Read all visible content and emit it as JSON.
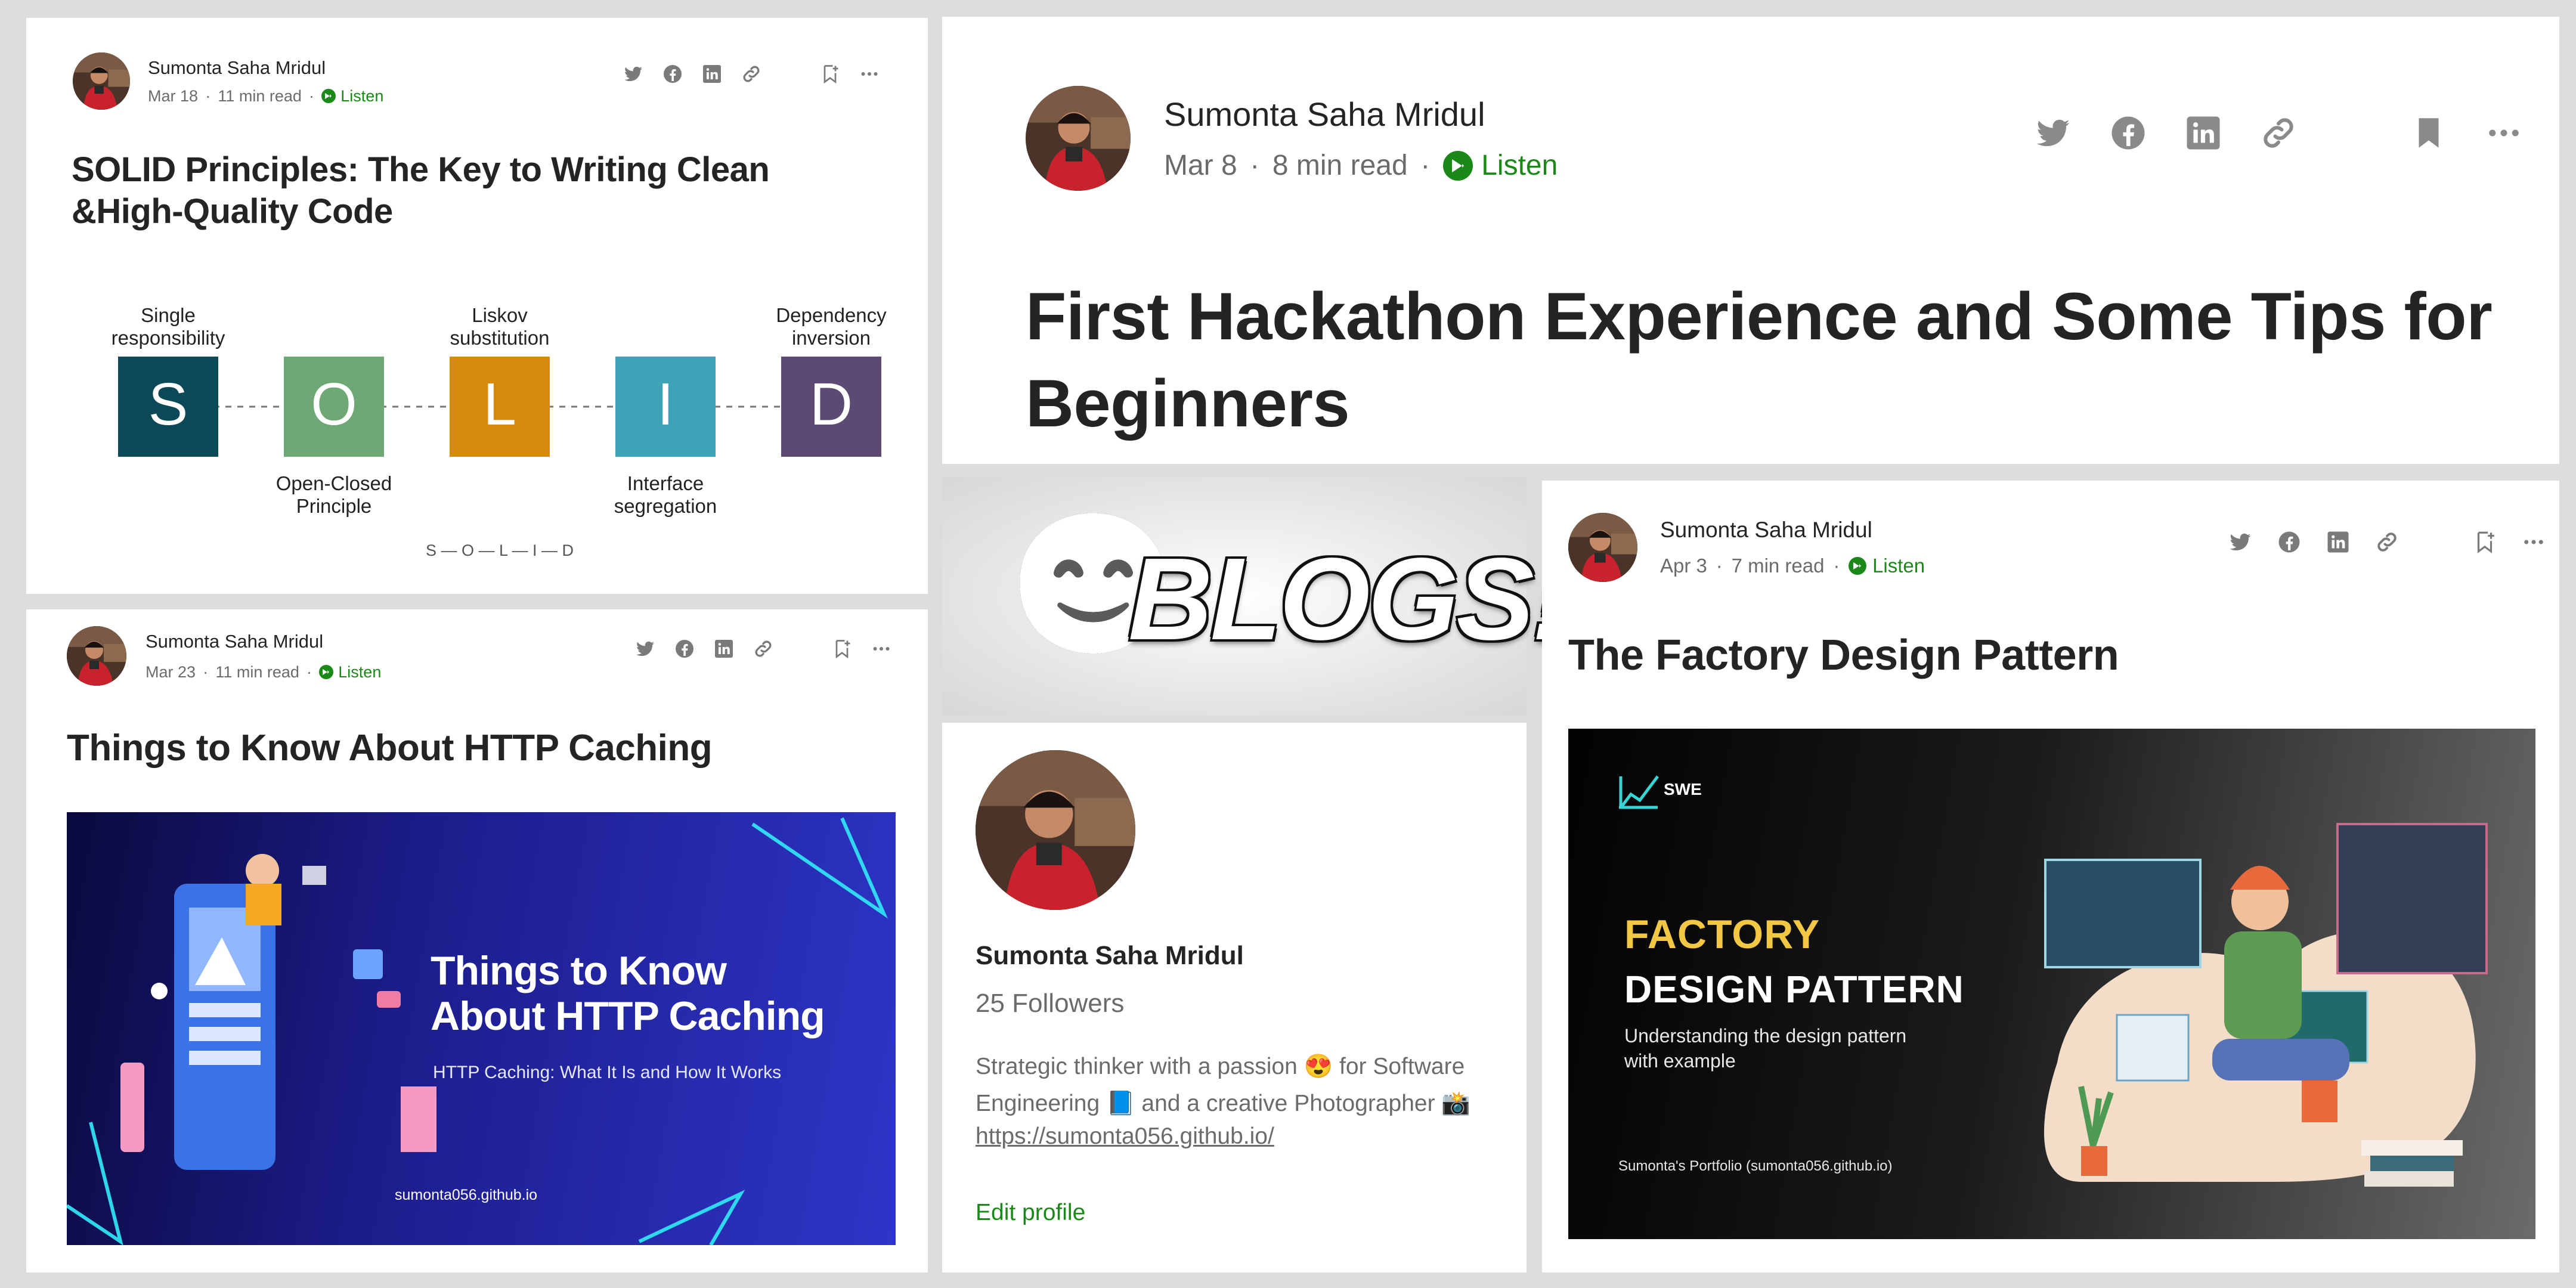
{
  "colors": {
    "listen": "#1a8917",
    "meta": "#6b6b6b",
    "title": "#242424",
    "background": "#dcdcdc"
  },
  "cards": [
    {
      "author": "Sumonta Saha Mridul",
      "date": "Mar 18",
      "read": "11 min read",
      "listen": "Listen",
      "title": "SOLID Principles: The Key to Writing Clean &High-Quality Code",
      "diagram": {
        "letters": [
          "S",
          "O",
          "L",
          "I",
          "D"
        ],
        "top_labels": [
          "Single\nresponsibility",
          "",
          "Liskov\nsubstitution",
          "",
          "Dependency\ninversion"
        ],
        "bottom_labels": [
          "",
          "Open-Closed\nPrinciple",
          "",
          "Interface\nsegregation",
          ""
        ],
        "colors": [
          "#0b4858",
          "#6ea875",
          "#d58a0c",
          "#3fa3b8",
          "#5d4a74"
        ],
        "footer": "S — O — L — I — D"
      }
    },
    {
      "author": "Sumonta Saha Mridul",
      "date": "Mar 8",
      "read": "8 min read",
      "listen": "Listen",
      "title": "First Hackathon Experience and Some Tips for Beginners"
    },
    {
      "author": "Sumonta Saha Mridul",
      "date": "Mar 23",
      "read": "11 min read",
      "listen": "Listen",
      "title": "Things to Know About HTTP Caching",
      "banner": {
        "heading": "Things to Know\nAbout HTTP Caching",
        "sub": "HTTP Caching: What It Is and How It Works",
        "site": "sumonta056.github.io"
      }
    },
    {
      "author": "Sumonta Saha Mridul",
      "date": "Apr 3",
      "read": "7 min read",
      "listen": "Listen",
      "title": "The Factory Design Pattern",
      "banner": {
        "brand": "SWE",
        "line1": "FACTORY",
        "line2": "DESIGN PATTERN",
        "sub": "Understanding the design pattern\nwith example",
        "footer": "Sumonta's Portfolio (sumonta056.github.io)"
      }
    }
  ],
  "hero": {
    "text": "BLOGS!",
    "emoji": "😊"
  },
  "profile": {
    "name": "Sumonta Saha Mridul",
    "followers": "25 Followers",
    "bio": "Strategic thinker with a passion 😍 for Software Engineering 📘 and a creative Photographer 📸",
    "link": "https://sumonta056.github.io/",
    "edit": "Edit profile"
  }
}
